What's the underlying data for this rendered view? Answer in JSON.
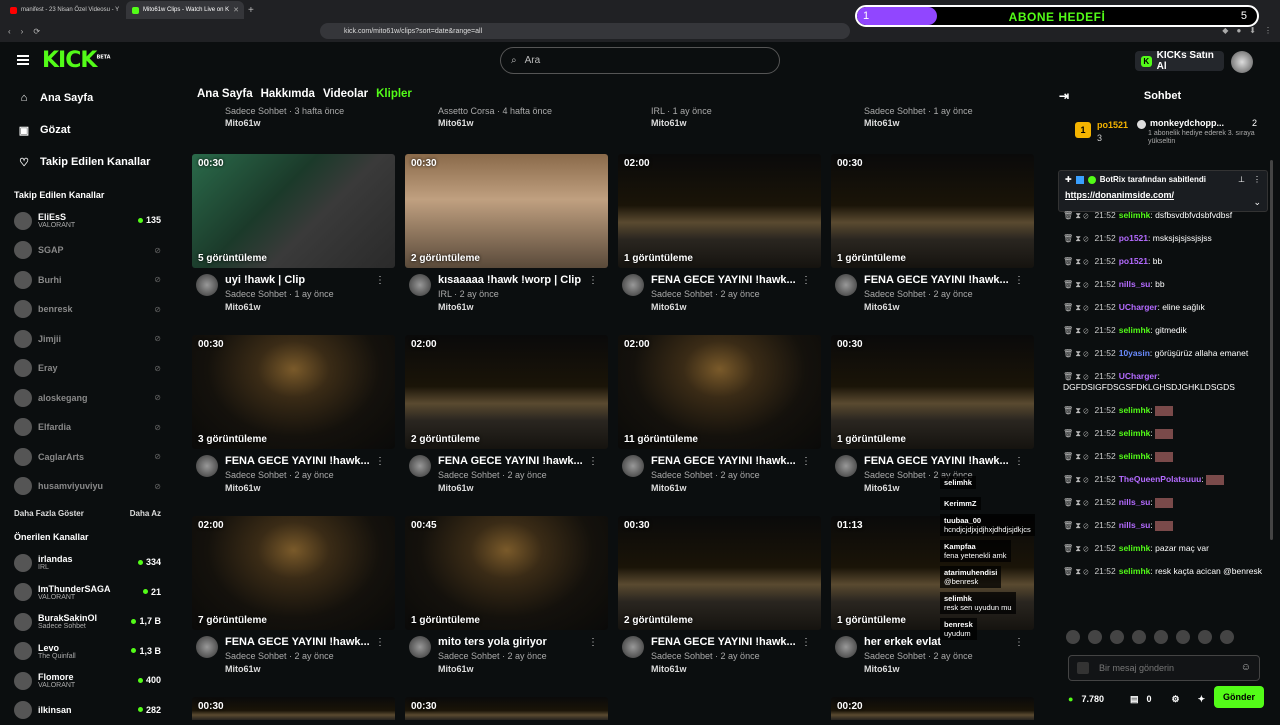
{
  "browser": {
    "tabs": [
      {
        "label": "manifest - 23 Nisan Özel Videosu - Y",
        "active": false,
        "color": "#ff0000"
      },
      {
        "label": "Mito61w Clips - Watch Live on K",
        "active": true,
        "color": "#53fc18"
      }
    ],
    "url": "kick.com/mito61w/clips?sort=date&range=all"
  },
  "sub_goal": {
    "current": "1",
    "label": "ABONE HEDEFİ",
    "target": "5",
    "progress": 0.2
  },
  "header": {
    "logo": "KICK",
    "logo_badge": "BETA",
    "search_placeholder": "Ara",
    "kicks_label": "KICKs Satın Al"
  },
  "nav": [
    {
      "label": "Ana Sayfa",
      "icon": "home-icon"
    },
    {
      "label": "Gözat",
      "icon": "browse-icon"
    },
    {
      "label": "Takip Edilen Kanallar",
      "icon": "heart-icon"
    }
  ],
  "followed": {
    "title": "Takip Edilen Kanallar",
    "channels": [
      {
        "name": "EliEsS",
        "category": "VALORANT",
        "viewers": "135",
        "live": true
      },
      {
        "name": "SGAP",
        "live": false
      },
      {
        "name": "Burhi",
        "live": false
      },
      {
        "name": "benresk",
        "live": false
      },
      {
        "name": "Jimjii",
        "live": false
      },
      {
        "name": "Eray",
        "live": false
      },
      {
        "name": "aloskegang",
        "live": false
      },
      {
        "name": "Elfardia",
        "live": false
      },
      {
        "name": "CaglarArts",
        "live": false
      },
      {
        "name": "husamviyuviyu",
        "live": false
      }
    ],
    "show_more": "Daha Fazla Göster",
    "show_less": "Daha Az"
  },
  "recommended": {
    "title": "Önerilen Kanallar",
    "channels": [
      {
        "name": "irlandas",
        "category": "IRL",
        "viewers": "334"
      },
      {
        "name": "ImThunderSAGA",
        "category": "VALORANT",
        "viewers": "21"
      },
      {
        "name": "BurakSakinOl",
        "category": "Sadece Sohbet",
        "viewers": "1,7 B"
      },
      {
        "name": "Levo",
        "category": "The Quinfall",
        "viewers": "1,3 B"
      },
      {
        "name": "Flomore",
        "category": "VALORANT",
        "viewers": "400"
      },
      {
        "name": "ilkinsan",
        "category": "",
        "viewers": "282"
      }
    ]
  },
  "page_tabs": [
    "Ana Sayfa",
    "Hakkımda",
    "Videolar",
    "Klipler"
  ],
  "partial_row": [
    {
      "sub": "Sadece Sohbet · 3 hafta önce",
      "owner": "Mito61w"
    },
    {
      "sub": "Assetto Corsa · 4 hafta önce",
      "owner": "Mito61w"
    },
    {
      "sub": "IRL · 1 ay önce",
      "owner": "Mito61w"
    },
    {
      "sub": "Sadece Sohbet · 1 ay önce",
      "owner": "Mito61w"
    }
  ],
  "clips": [
    {
      "duration": "00:30",
      "views": "5 görüntüleme",
      "title": "uyi !hawk | Clip",
      "sub": "Sadece Sohbet · 1 ay önce",
      "owner": "Mito61w"
    },
    {
      "duration": "00:30",
      "views": "2 görüntüleme",
      "title": "kısaaaaa !hawk !worp | Clip",
      "sub": "IRL · 2 ay önce",
      "owner": "Mito61w"
    },
    {
      "duration": "02:00",
      "views": "1 görüntüleme",
      "title": "FENA GECE YAYINI !hawk...",
      "sub": "Sadece Sohbet · 2 ay önce",
      "owner": "Mito61w"
    },
    {
      "duration": "00:30",
      "views": "1 görüntüleme",
      "title": "FENA GECE YAYINI !hawk...",
      "sub": "Sadece Sohbet · 2 ay önce",
      "owner": "Mito61w"
    },
    {
      "duration": "00:30",
      "views": "3 görüntüleme",
      "title": "FENA GECE YAYINI !hawk...",
      "sub": "Sadece Sohbet · 2 ay önce",
      "owner": "Mito61w"
    },
    {
      "duration": "02:00",
      "views": "2 görüntüleme",
      "title": "FENA GECE YAYINI !hawk...",
      "sub": "Sadece Sohbet · 2 ay önce",
      "owner": "Mito61w"
    },
    {
      "duration": "02:00",
      "views": "11 görüntüleme",
      "title": "FENA GECE YAYINI !hawk...",
      "sub": "Sadece Sohbet · 2 ay önce",
      "owner": "Mito61w"
    },
    {
      "duration": "00:30",
      "views": "1 görüntüleme",
      "title": "FENA GECE YAYINI !hawk...",
      "sub": "Sadece Sohbet · 2 ay önce",
      "owner": "Mito61w"
    },
    {
      "duration": "02:00",
      "views": "7 görüntüleme",
      "title": "FENA GECE YAYINI !hawk...",
      "sub": "Sadece Sohbet · 2 ay önce",
      "owner": "Mito61w"
    },
    {
      "duration": "00:45",
      "views": "1 görüntüleme",
      "title": "mito ters yola giriyor",
      "sub": "Sadece Sohbet · 2 ay önce",
      "owner": "Mito61w"
    },
    {
      "duration": "00:30",
      "views": "2 görüntüleme",
      "title": "FENA GECE YAYINI !hawk...",
      "sub": "Sadece Sohbet · 2 ay önce",
      "owner": "Mito61w"
    },
    {
      "duration": "01:13",
      "views": "1 görüntüleme",
      "title": "her erkek evlat",
      "sub": "Sadece Sohbet · 2 ay önce",
      "owner": "Mito61w"
    }
  ],
  "bottom_durations": [
    "00:30",
    "00:30",
    "00:20"
  ],
  "chat": {
    "title": "Sohbet",
    "top_gifter": {
      "name": "po1521",
      "count": "3"
    },
    "gifter2": {
      "name": "monkeydchopp...",
      "count": "2",
      "note": "1 abonelik hediye ederek 3. sıraya yükseltin"
    },
    "pinned": {
      "by": "BotRix tarafından sabitlendi",
      "link": "https://donanimside.com/"
    },
    "messages": [
      {
        "time": "21:52",
        "user": "selimhk",
        "text": "dsfbsvdbfvdsbfvdbsf",
        "color": "#53fc18"
      },
      {
        "time": "21:52",
        "user": "po1521",
        "text": "msksjsjsjssjsjss",
        "color": "#b46bff"
      },
      {
        "time": "21:52",
        "user": "po1521",
        "text": "bb",
        "color": "#b46bff"
      },
      {
        "time": "21:52",
        "user": "nills_su",
        "text": "bb",
        "color": "#b46bff"
      },
      {
        "time": "21:52",
        "user": "UCharger",
        "text": "eline sağlık",
        "color": "#b46bff"
      },
      {
        "time": "21:52",
        "user": "selimhk",
        "text": "gitmedik",
        "color": "#53fc18"
      },
      {
        "time": "21:52",
        "user": "10yasin",
        "text": "görüşürüz allaha emanet",
        "color": "#6b8cff"
      },
      {
        "time": "21:52",
        "user": "UCharger",
        "text": "DGFDSIGFDSGSFDKLGHSDJGHKLDSGDS",
        "color": "#b46bff"
      },
      {
        "time": "21:52",
        "user": "selimhk",
        "text": "",
        "color": "#53fc18"
      },
      {
        "time": "21:52",
        "user": "selimhk",
        "text": "",
        "color": "#53fc18"
      },
      {
        "time": "21:52",
        "user": "selimhk",
        "text": "",
        "color": "#53fc18"
      },
      {
        "time": "21:52",
        "user": "TheQueenPolatsuuu",
        "text": "",
        "color": "#b46bff"
      },
      {
        "time": "21:52",
        "user": "nills_su",
        "text": "",
        "color": "#b46bff"
      },
      {
        "time": "21:52",
        "user": "nills_su",
        "text": "",
        "color": "#b46bff"
      },
      {
        "time": "21:52",
        "user": "selimhk",
        "text": "pazar maç var",
        "color": "#53fc18"
      },
      {
        "time": "21:52",
        "user": "selimhk",
        "text": "resk kaçta acican @benresk",
        "color": "#53fc18"
      }
    ],
    "input_placeholder": "Bir mesaj gönderin",
    "points": "7.780",
    "kicks": "0",
    "send": "Gönder"
  },
  "overlay_chat": [
    {
      "user": "selimhk",
      "text": ""
    },
    {
      "user": "KerimmZ",
      "text": ""
    },
    {
      "user": "tuubaa_00",
      "text": "hcndjcjdjxjdjhxjdhdjsjdkjcs"
    },
    {
      "user": "Kampfaa",
      "text": "fena yetenekli amk"
    },
    {
      "user": "atarimuhendisi",
      "text": "@benresk"
    },
    {
      "user": "selimhk",
      "text": "resk sen uyudun mu"
    },
    {
      "user": "benresk",
      "text": "uyudum"
    }
  ]
}
